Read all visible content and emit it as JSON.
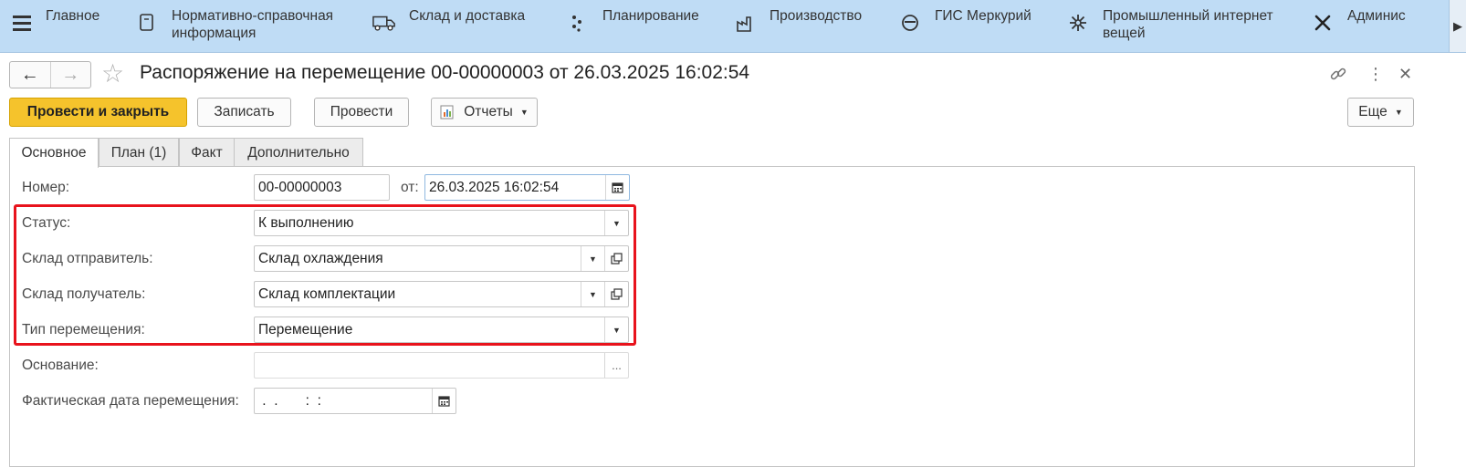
{
  "sections": [
    {
      "label": "Главное",
      "icon": "menu-icon"
    },
    {
      "label": "Нормативно-справочная\nинформация",
      "icon": "reference-book-icon"
    },
    {
      "label": "Склад и доставка",
      "icon": "truck-icon"
    },
    {
      "label": "Планирование",
      "icon": "planning-dots-icon"
    },
    {
      "label": "Производство",
      "icon": "factory-icon"
    },
    {
      "label": "ГИС Меркурий",
      "icon": "mercury-icon"
    },
    {
      "label": "Промышленный интернет\nвещей",
      "icon": "iot-icon"
    },
    {
      "label": "Админис",
      "icon": "tools-icon"
    }
  ],
  "header": {
    "title": "Распоряжение на перемещение 00-00000003 от 26.03.2025 16:02:54"
  },
  "toolbar": {
    "post_close": "Провести и закрыть",
    "save": "Записать",
    "post": "Провести",
    "reports": "Отчеты",
    "more": "Еще"
  },
  "tabs": [
    {
      "label": "Основное"
    },
    {
      "label": "План (1)"
    },
    {
      "label": "Факт"
    },
    {
      "label": "Дополнительно"
    }
  ],
  "form": {
    "number_label": "Номер:",
    "number_value": "00-00000003",
    "from_label": "от:",
    "date_value": "26.03.2025 16:02:54",
    "status_label": "Статус:",
    "status_value": "К выполнению",
    "sender_label": "Склад отправитель:",
    "sender_value": "Склад охлаждения",
    "receiver_label": "Склад получатель:",
    "receiver_value": "Склад комплектации",
    "type_label": "Тип перемещения:",
    "type_value": "Перемещение",
    "basis_label": "Основание:",
    "basis_value": "",
    "basis_button": "...",
    "actual_date_label": "Фактическая дата перемещения:",
    "actual_date_value": " .  .       :  :"
  },
  "colors": {
    "sections_bar": "#bfdcf5",
    "primary_button": "#f5c32c",
    "highlight_frame": "#e8131c"
  }
}
